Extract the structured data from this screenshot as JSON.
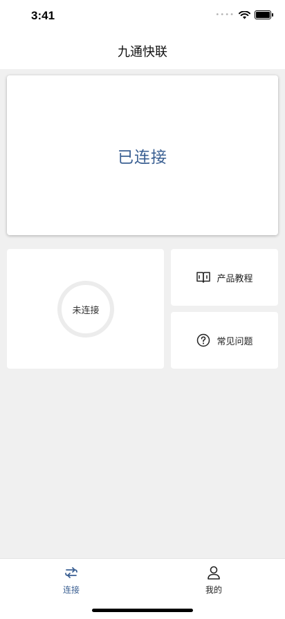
{
  "status_bar": {
    "time": "3:41"
  },
  "nav": {
    "title": "九通快联"
  },
  "hero": {
    "status_text": "已连接"
  },
  "connection": {
    "status_text": "未连接"
  },
  "actions": {
    "tutorial_label": "产品教程",
    "faq_label": "常见问题"
  },
  "tabs": {
    "connect_label": "连接",
    "mine_label": "我的"
  },
  "colors": {
    "accent": "#3a5f92",
    "background": "#f0f0f0",
    "card": "#ffffff"
  },
  "icons": {
    "tutorial": "book-icon",
    "faq": "question-circle-icon",
    "connect_tab": "connect-icon",
    "mine_tab": "user-icon"
  }
}
